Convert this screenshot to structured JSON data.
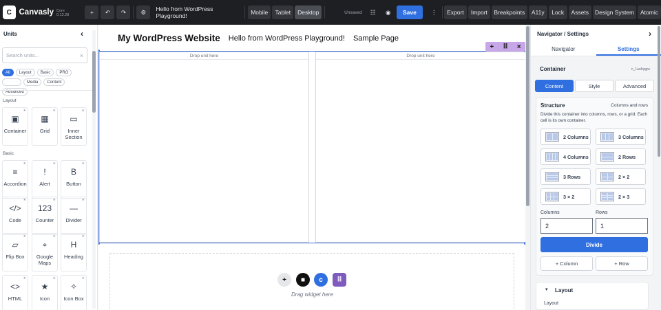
{
  "topbar": {
    "logo": "C",
    "brand": "Canvasly",
    "version": "Core 0.12.28",
    "page_title": "Hello from WordPress Playground!",
    "devices": [
      "Mobile",
      "Tablet",
      "Desktop"
    ],
    "status": "Unsaved",
    "save": "Save",
    "menu": [
      "Export",
      "Import",
      "Breakpoints",
      "A11y",
      "Lock",
      "Assets",
      "Design System",
      "Atomic"
    ],
    "icons": {
      "add": "+",
      "undo": "↶",
      "redo": "↷",
      "settings": "⚙",
      "more": "⋮"
    }
  },
  "left": {
    "title": "Units",
    "collapse": "‹",
    "search_placeholder": "Search units...",
    "clear": "×",
    "filters": [
      "All",
      "Layout",
      "Basic",
      "PRO",
      "Media",
      "Content",
      "Advanced"
    ],
    "sections": {
      "layout": "Layout",
      "basic": "Basic"
    },
    "units": [
      {
        "label": "Container",
        "icon": "▣"
      },
      {
        "label": "Grid",
        "icon": "▦"
      },
      {
        "label": "Inner Section",
        "icon": "▭"
      },
      {
        "label": "Accordion",
        "icon": "≡"
      },
      {
        "label": "Alert",
        "icon": "!"
      },
      {
        "label": "Button",
        "icon": "B"
      },
      {
        "label": "Code",
        "icon": "</>"
      },
      {
        "label": "Counter",
        "icon": "123"
      },
      {
        "label": "Divider",
        "icon": "—"
      },
      {
        "label": "Flip Box",
        "icon": "▱"
      },
      {
        "label": "Google Maps",
        "icon": "⌖"
      },
      {
        "label": "Heading",
        "icon": "H"
      },
      {
        "label": "HTML",
        "icon": "<>"
      },
      {
        "label": "Icon",
        "icon": "★"
      },
      {
        "label": "Icon Box",
        "icon": "✧"
      }
    ],
    "star": "★"
  },
  "canvas": {
    "site_title": "My WordPress Website",
    "nav": [
      "Hello from WordPress Playground!",
      "Sample Page"
    ],
    "drop_label": "Drop unit here",
    "toolbar": {
      "add": "+",
      "move": "⠿",
      "close": "×"
    },
    "drag_hint": "Drag widget here",
    "add_icons": [
      "+",
      "■",
      "c",
      "⠿"
    ]
  },
  "right": {
    "title": "Navigator / Settings",
    "collapse": "›",
    "tabs": [
      "Navigator",
      "Settings"
    ],
    "element": "Container",
    "element_id": "n_1aafqqgw",
    "subtabs": [
      "Content",
      "Style",
      "Advanced"
    ],
    "structure_title": "Structure",
    "structure_sub": "Columns and rows",
    "structure_desc": "Divide this container into columns, rows, or a grid. Each cell is its own container.",
    "layouts": [
      "2 Columns",
      "3 Columns",
      "4 Columns",
      "2 Rows",
      "3 Rows",
      "2 × 2",
      "3 × 2",
      "2 × 3"
    ],
    "columns_label": "Columns",
    "rows_label": "Rows",
    "columns_value": "2",
    "rows_value": "1",
    "divide": "Divide",
    "add_column": "+ Column",
    "add_row": "+ Row",
    "layout_section": "Layout",
    "layout_label": "Layout",
    "layout_toggle": "▾"
  },
  "colors": {
    "accent": "#2f6fe0",
    "topbar": "#1e1f22",
    "selection": "#3b6fd8",
    "toolbar": "#c7a7e8"
  }
}
